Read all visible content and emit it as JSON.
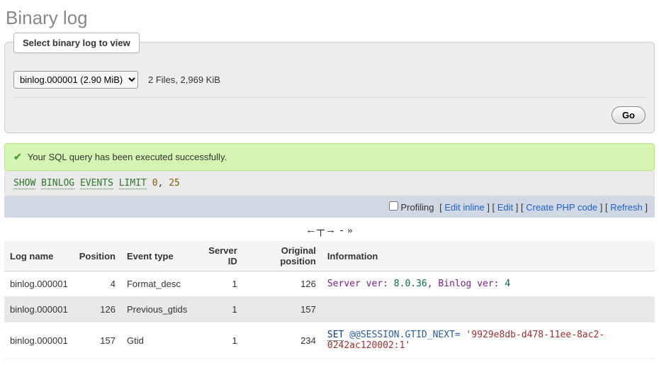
{
  "page_title": "Binary log",
  "panel": {
    "legend": "Select binary log to view",
    "select_value": "binlog.000001 (2.90 MiB)",
    "files_summary": "2 Files, 2,969 KiB",
    "go_label": "Go"
  },
  "success_msg": "Your SQL query has been executed successfully.",
  "sql": {
    "show": "SHOW",
    "binlog": "BINLOG",
    "events": "EVENTS",
    "limit": "LIMIT",
    "n0": "0",
    "comma": ", ",
    "n1": "25"
  },
  "actions": {
    "profiling": "Profiling",
    "edit_inline": "Edit inline",
    "edit": "Edit",
    "create_php": "Create PHP code",
    "refresh": "Refresh"
  },
  "nav_arrows": "←┬→ - »",
  "columns": {
    "log_name": "Log name",
    "position": "Position",
    "event_type": "Event type",
    "server_id": "Server ID",
    "original_position": "Original position",
    "information": "Information"
  },
  "rows": [
    {
      "log_name": "binlog.000001",
      "position": "4",
      "event_type": "Format_desc",
      "server_id": "1",
      "original_position": "126",
      "info": {
        "type": "server",
        "p1": "Server ver: ",
        "p2": "8.0.36",
        "p3": ", Binlog ver: ",
        "p4": "4"
      }
    },
    {
      "log_name": "binlog.000001",
      "position": "126",
      "event_type": "Previous_gtids",
      "server_id": "1",
      "original_position": "157",
      "info": {
        "type": "empty"
      }
    },
    {
      "log_name": "binlog.000001",
      "position": "157",
      "event_type": "Gtid",
      "server_id": "1",
      "original_position": "234",
      "info": {
        "type": "set",
        "set": "SET",
        "var": " @@SESSION.GTID_NEXT= ",
        "val": "'9929e8db-d478-11ee-8ac2-0242ac120002:1'"
      }
    }
  ]
}
